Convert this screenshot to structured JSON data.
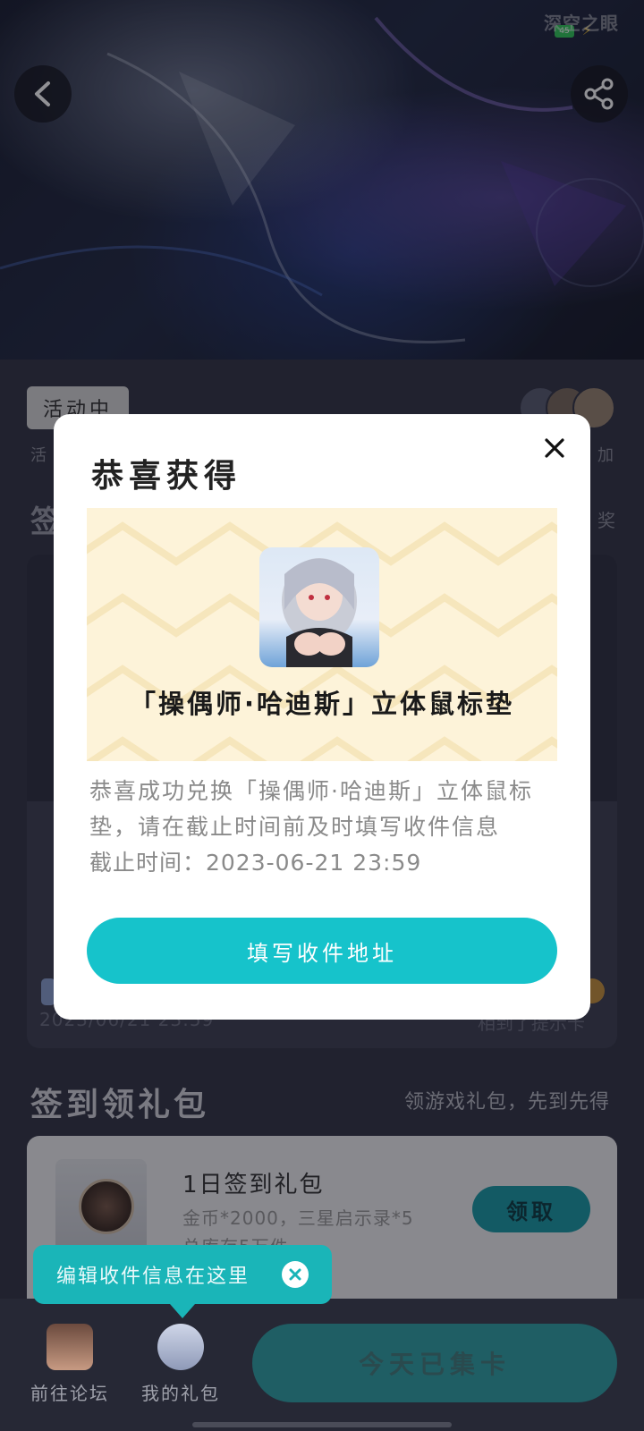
{
  "status_bar": {
    "watermark": "深空之眼",
    "battery": "45"
  },
  "hero": {
    "back_icon": "chevron-left-icon",
    "share_icon": "share-icon"
  },
  "activity": {
    "status_tag": "活动中"
  },
  "background": {
    "frag_left": "活",
    "frag_right": "加",
    "frag_title": "签",
    "frag_right2": "奖",
    "date": "2023/06/21 23:59",
    "collect_hint": "相到了提示卡"
  },
  "gift_section": {
    "title": "签到领礼包",
    "subtitle": "领游戏礼包，先到先得",
    "item": {
      "name": "1日签到礼包",
      "desc": "金币*2000，三星启示录*5",
      "desc2": "总库存5万件",
      "claim_label": "领取"
    }
  },
  "tooltip": {
    "text": "编辑收件信息在这里",
    "close_icon": "close-icon"
  },
  "bottom_nav": {
    "forum_label": "前往论坛",
    "gift_label": "我的礼包",
    "collect_label": "今天已集卡"
  },
  "modal": {
    "title": "恭喜获得",
    "prize_name": "「操偶师·哈迪斯」立体鼠标垫",
    "description": "恭喜成功兑换「操偶师·哈迪斯」立体鼠标垫，请在截止时间前及时填写收件信息",
    "deadline": "截止时间：2023-06-21 23:59",
    "button_label": "填写收件地址",
    "close_icon": "close-icon"
  },
  "colors": {
    "accent": "#16c3cb",
    "prize_bg": "#fdf3d9",
    "tooltip": "#1ab5b8"
  }
}
